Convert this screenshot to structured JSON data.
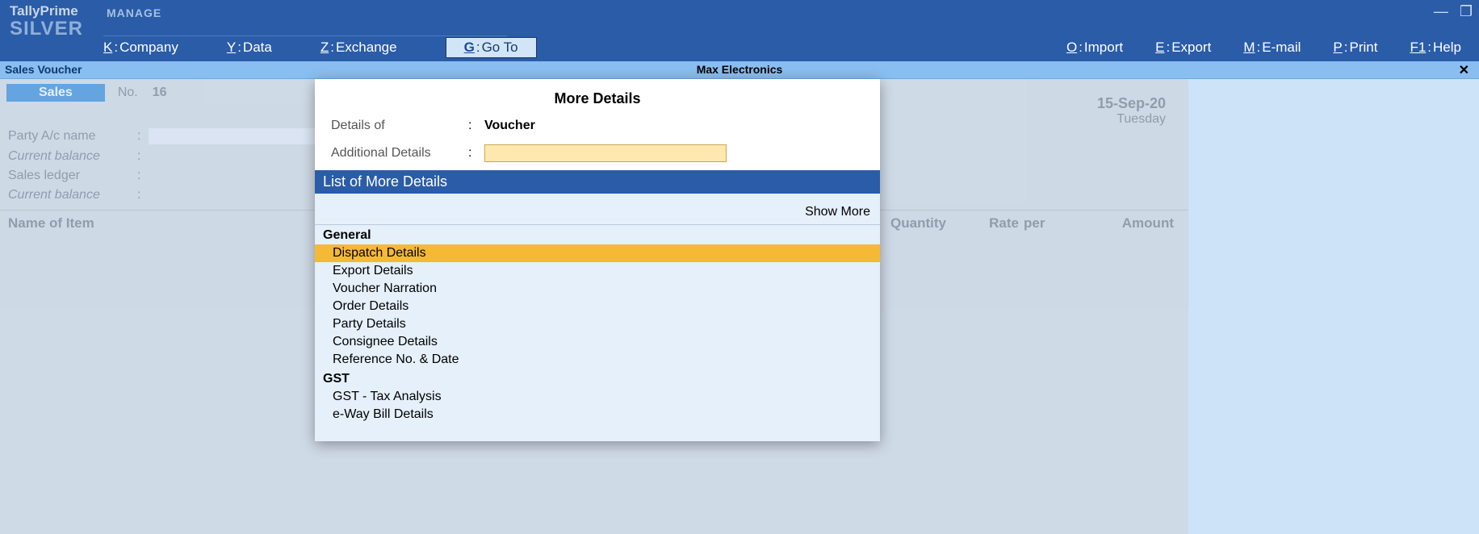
{
  "app": {
    "name": "TallyPrime",
    "edition": "SILVER",
    "manage": "MANAGE"
  },
  "menu": {
    "company": {
      "hot": "K",
      "label": "Company"
    },
    "data": {
      "hot": "Y",
      "label": "Data"
    },
    "exchange": {
      "hot": "Z",
      "label": "Exchange"
    },
    "goto": {
      "hot": "G",
      "label": "Go To"
    },
    "import": {
      "hot": "O",
      "label": "Import"
    },
    "export": {
      "hot": "E",
      "label": "Export"
    },
    "email": {
      "hot": "M",
      "label": "E-mail"
    },
    "print": {
      "hot": "P",
      "label": "Print"
    },
    "help": {
      "hot": "F1",
      "label": "Help"
    }
  },
  "companybar": {
    "left": "Sales Voucher",
    "center": "Max Electronics"
  },
  "voucher": {
    "badge": "Sales",
    "no_lbl": "No.",
    "no_val": "16",
    "date": "15-Sep-20",
    "day": "Tuesday",
    "party_lbl": "Party A/c name",
    "curbal_lbl": "Current balance",
    "sledger_lbl": "Sales ledger",
    "cols": {
      "name": "Name of Item",
      "qty": "Quantity",
      "rate": "Rate",
      "per": "per",
      "amt": "Amount"
    }
  },
  "popup": {
    "title": "More Details",
    "detailsof_lbl": "Details of",
    "detailsof_val": "Voucher",
    "additional_lbl": "Additional Details",
    "list_header": "List of More Details",
    "show_more": "Show More",
    "groups": {
      "general": {
        "title": "General",
        "items": [
          "Dispatch Details",
          "Export Details",
          "Voucher Narration",
          "Order Details",
          "Party Details",
          "Consignee Details",
          "Reference No. & Date"
        ]
      },
      "gst": {
        "title": "GST",
        "items": [
          "GST - Tax Analysis",
          "e-Way Bill Details"
        ]
      }
    },
    "selected": "Dispatch Details"
  }
}
